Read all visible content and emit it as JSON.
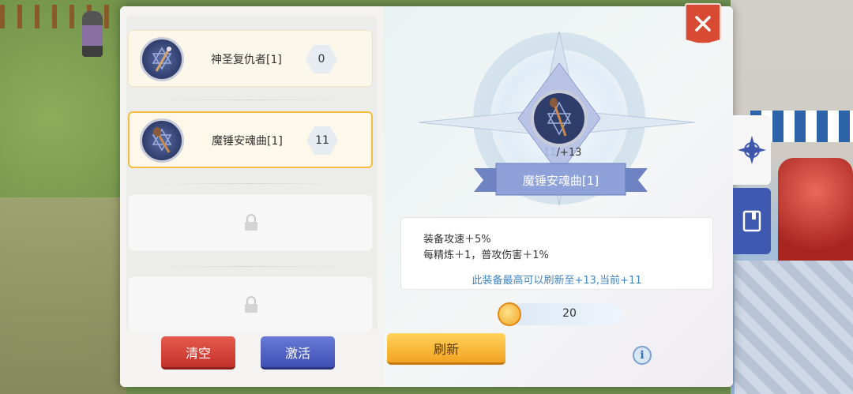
{
  "window": {
    "close_icon": "close-x-icon"
  },
  "equipment_list": [
    {
      "name": "神圣复仇者[1]",
      "level": "0",
      "state": "filled",
      "icon": "staff-hexagram-icon"
    },
    {
      "name": "魔锤安魂曲[1]",
      "level": "11",
      "state": "selected",
      "icon": "mace-hexagram-icon"
    },
    {
      "state": "locked",
      "icon": "lock-icon"
    },
    {
      "state": "locked",
      "icon": "lock-icon"
    }
  ],
  "buttons": {
    "clear_label": "清空",
    "activate_label": "激活",
    "refresh_label": "刷新"
  },
  "detail": {
    "item_name": "魔锤安魂曲[1]",
    "current_level": "11",
    "max_level_text": "/+13",
    "effects": [
      "装备攻速＋5%",
      "每精炼＋1，普攻伤害＋1%"
    ],
    "note": "此装备最高可以刷新至+13,当前+11",
    "cost": "20",
    "cost_icon": "coin-icon",
    "info_icon": "info-icon"
  },
  "side_tabs": [
    "compass-icon",
    "book-icon"
  ],
  "colors": {
    "accent_orange": "#f5bd45",
    "close_red": "#d84a34",
    "note_blue": "#3f84c2",
    "activate_blue": "#3f4fb3",
    "clear_red": "#c4302a"
  }
}
